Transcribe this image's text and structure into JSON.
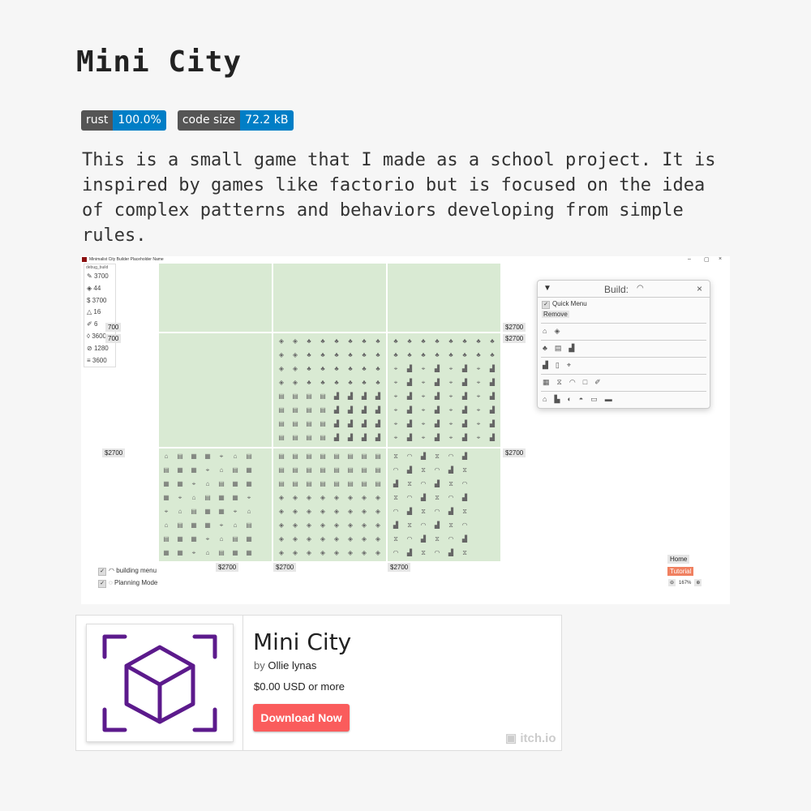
{
  "page": {
    "title": "Mini City",
    "badges": [
      {
        "key": "rust",
        "value": "100.0%"
      },
      {
        "key": "code size",
        "value": "72.2 kB"
      }
    ],
    "description": "This is a small game that I made as a school project. It is inspired by games like factorio but is focused on the idea of complex patterns and behaviors developing from simple rules."
  },
  "screenshot": {
    "window_title": "Minimalist City Builder Placeholder Name",
    "window_controls": [
      "–",
      "▢",
      "×"
    ],
    "debug": {
      "header": "debug_build",
      "resources": [
        {
          "icon": "money-icon",
          "value": "3700"
        },
        {
          "icon": "pill-icon",
          "value": "44"
        },
        {
          "icon": "dollar-icon",
          "value": "3700"
        },
        {
          "icon": "bell-icon",
          "value": "16"
        },
        {
          "icon": "pencil-icon",
          "value": "6"
        },
        {
          "icon": "drop-icon",
          "value": "3600"
        },
        {
          "icon": "no-pen-icon",
          "value": "1280"
        },
        {
          "icon": "database-icon",
          "value": "3600"
        }
      ]
    },
    "prices": {
      "p1": "700",
      "p2": "700",
      "p3": "$2700",
      "p4": "$2700",
      "p5": "$2700",
      "p6": "$2700",
      "p7": "$2700",
      "p8": "$2700",
      "p9": "$2700"
    },
    "build_panel": {
      "title": "Build:",
      "quick_menu": "Quick Menu",
      "remove": "Remove"
    },
    "bottom": {
      "building_menu": "building menu",
      "planning_mode": "Planning Mode",
      "home": "Home",
      "tutorial": "Tutorial",
      "zoom": "167%"
    }
  },
  "card": {
    "title": "Mini City",
    "by_prefix": "by",
    "author": "Ollie lynas",
    "price": "$0.00 USD",
    "price_suffix": "or more",
    "download": "Download Now",
    "brand": "itch.io",
    "logo_color": "#5c1a8c"
  }
}
